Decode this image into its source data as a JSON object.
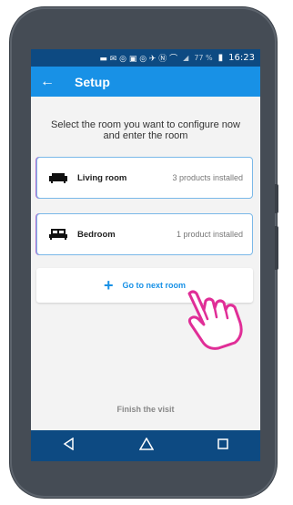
{
  "status_bar": {
    "battery": "77 %",
    "time": "16:23"
  },
  "app_bar": {
    "title": "Setup"
  },
  "prompt": "Select the room you want to configure now and enter the room",
  "rooms": [
    {
      "name": "Living room",
      "count": "3 products installed",
      "icon": "sofa-icon"
    },
    {
      "name": "Bedroom",
      "count": "1 product installed",
      "icon": "bed-icon"
    }
  ],
  "next_room": {
    "label": "Go to next room",
    "icon": "plus-icon"
  },
  "finish": "Finish the visit",
  "colors": {
    "accent": "#1891e6",
    "status_bar": "#0d4a82",
    "hand_outline": "#e02e97"
  }
}
